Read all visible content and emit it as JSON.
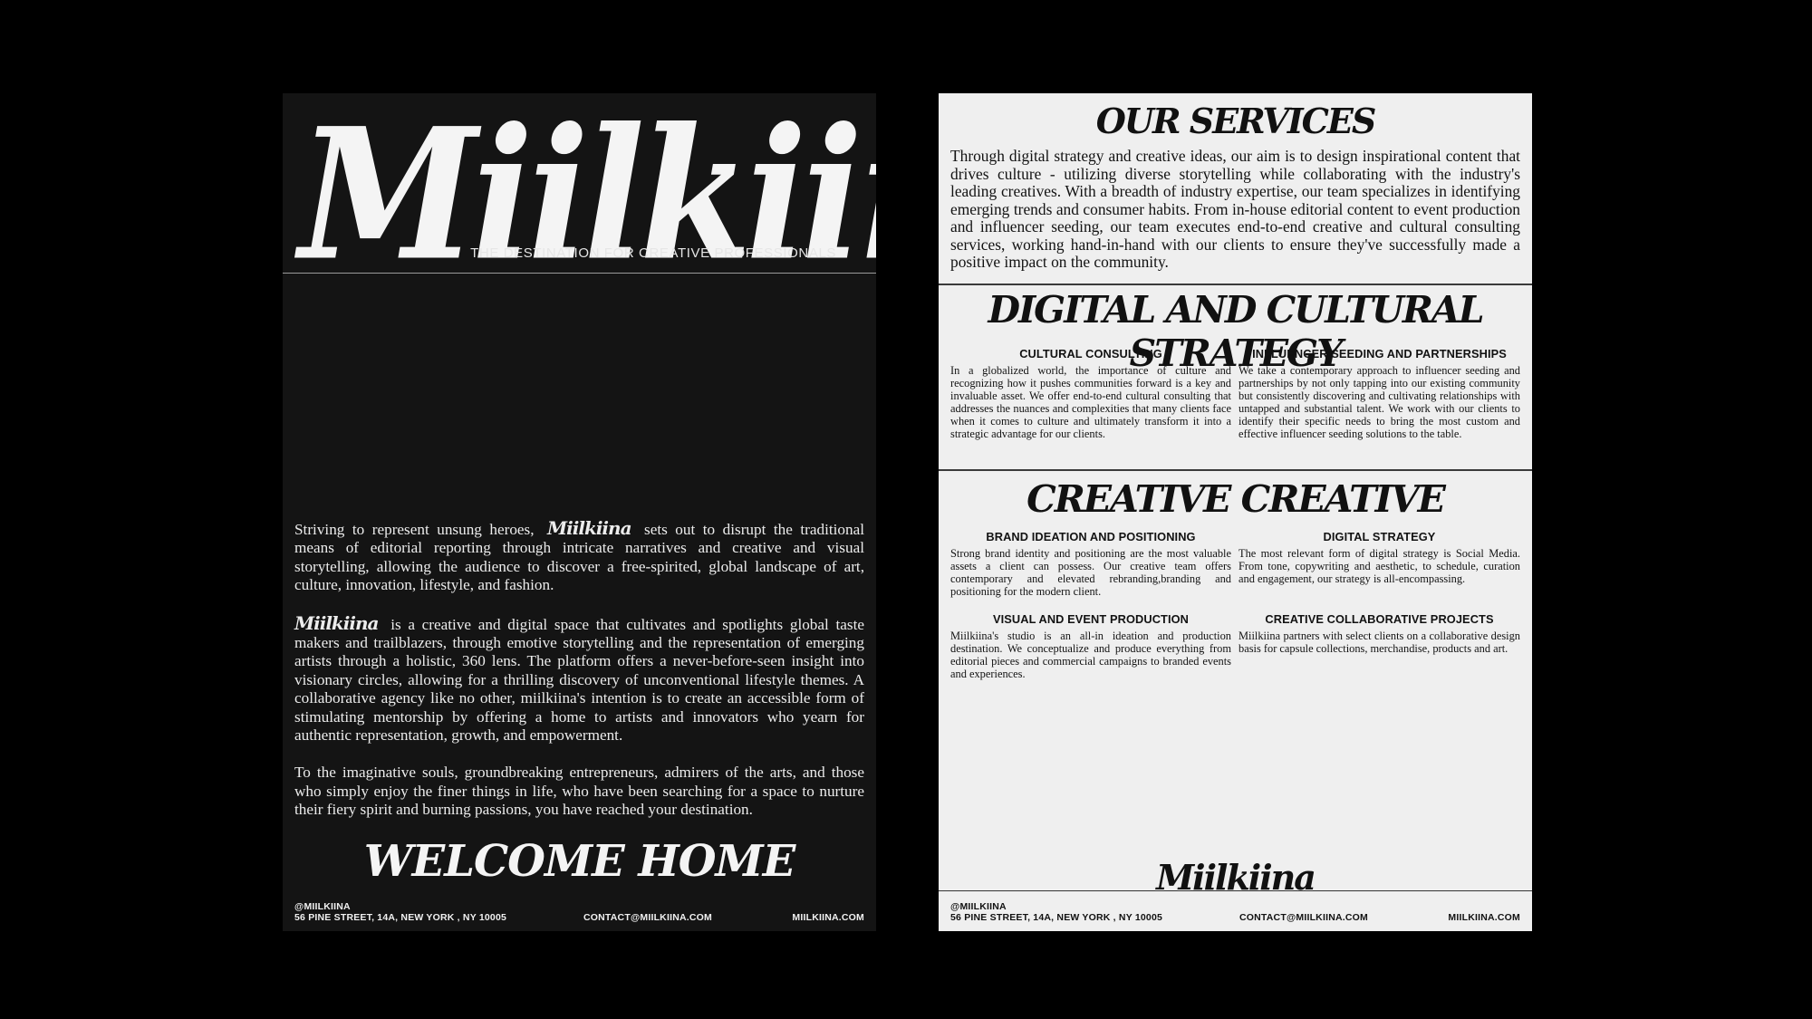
{
  "left_sheet": {
    "masthead": "Miilkiina",
    "tagline": "THE DESTINATION FOR CREATIVE PROFESSIONALS",
    "para1_before": "Striving to represent unsung heroes,",
    "para1_logo": "Miilkiina",
    "para1_after": "sets out to disrupt the traditional means of editorial reporting through intricate narratives and creative and visual storytelling, allowing the audience to discover a free-spirited, global landscape of art, culture, innovation, lifestyle, and fashion.",
    "para2_logo": "Miilkiina",
    "para2_after": "is a creative and digital space that cultivates and spotlights global taste makers and trailblazers, through emotive storytelling and the representation of emerging artists through a holistic, 360 lens. The platform offers a never-before-seen insight into visionary circles, allowing for a thrilling discovery of unconventional lifestyle themes. A collaborative agency like no other, miilkiina's intention is to create an accessible form of stimulating mentorship by offering a home to artists and innovators who yearn for authentic representation, growth, and empowerment.",
    "para3": "To the imaginative souls, groundbreaking entrepreneurs, admirers of the arts, and those who simply enjoy the finer things in life, who have been searching for a space to nurture their fiery spirit and burning passions, you have reached your destination.",
    "welcome": "WELCOME HOME"
  },
  "footer": {
    "handle": "@MIILKIINA",
    "address": "56 PINE STREET, 14A, NEW YORK , NY 10005",
    "email": "CONTACT@MIILKIINA.COM",
    "website": "MIILKIINA.COM"
  },
  "right_sheet": {
    "services_title": "OUR SERVICES",
    "services_body": "Through digital strategy and creative ideas, our aim is to design inspirational content that drives culture - utilizing diverse storytelling while collaborating with the industry's leading creatives. With a breadth of industry expertise, our team specializes in identifying emerging trends and consumer habits. From in-house editorial content to event production and influencer seeding, our team executes end-to-end creative and cultural consulting services, working hand-in-hand with our clients to ensure they've successfully made a positive impact on the community.",
    "digital_title": "DIGITAL AND CULTURAL STRATEGY",
    "cultural_consulting_heading": "CULTURAL CONSULTING",
    "cultural_consulting_body": "In a globalized world, the importance of culture and recognizing how it pushes communities forward is a key and invaluable asset. We offer end-to-end cultural consulting that addresses the nuances and complexities that many clients face when it comes to culture and ultimately transform it into a strategic advantage for our clients.",
    "influencer_heading": "INFLUENCER SEEDING AND PARTNERSHIPS",
    "influencer_body": "We take a contemporary approach to influencer seeding and partnerships by not only tapping into our existing community but consistently discovering and cultivating relationships with untapped and substantial talent. We work with our clients to identify their specific needs to bring the most custom and effective influencer seeding solutions to the table.",
    "creative_title": "CREATIVE CREATIVE",
    "brand_heading": "BRAND IDEATION AND POSITIONING",
    "brand_body": "Strong brand identity and positioning are the most valuable assets a client can possess. Our creative team offers contemporary and elevated rebranding,branding and positioning for the modern client.",
    "digital_strategy_heading": "DIGITAL STRATEGY",
    "digital_strategy_body": "The most relevant form of digital strategy is Social Media. From tone, copywriting and aesthetic, to schedule, curation and engagement, our strategy is all-encompassing.",
    "visual_heading": "VISUAL AND EVENT PRODUCTION",
    "visual_body": "Miilkiina's studio is an all-in ideation and production destination. We conceptualize and produce everything from editorial pieces and commercial campaigns to branded events and experiences.",
    "collab_heading": "CREATIVE COLLABORATIVE PROJECTS",
    "collab_body": "Miilkiina partners with select clients on a collaborative design basis for capsule collections, merchandise, products and art.",
    "footer_logo": "Miilkiina"
  }
}
